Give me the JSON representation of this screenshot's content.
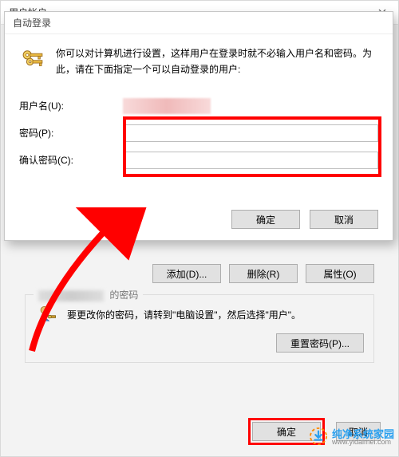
{
  "outer": {
    "title": "用户帐户",
    "add_btn": "添加(D)...",
    "remove_btn": "删除(R)",
    "properties_btn": "属性(O)",
    "pwd_group_suffix": "的密码",
    "pwd_change_text": "要更改你的密码，请转到\"电脑设置\"，然后选择\"用户\"。",
    "reset_pwd_btn": "重置密码(P)...",
    "ok_btn": "确定",
    "cancel_btn": "取消"
  },
  "inner": {
    "title": "自动登录",
    "message": "你可以对计算机进行设置，这样用户在登录时就不必输入用户名和密码。为此，请在下面指定一个可以自动登录的用户:",
    "username_label": "用户名(U):",
    "password_label": "密码(P):",
    "confirm_label": "确认密码(C):",
    "ok_btn": "确定",
    "cancel_btn": "取消"
  },
  "watermark": {
    "name": "纯净系统家园",
    "url": "www.yidaimei.com"
  }
}
